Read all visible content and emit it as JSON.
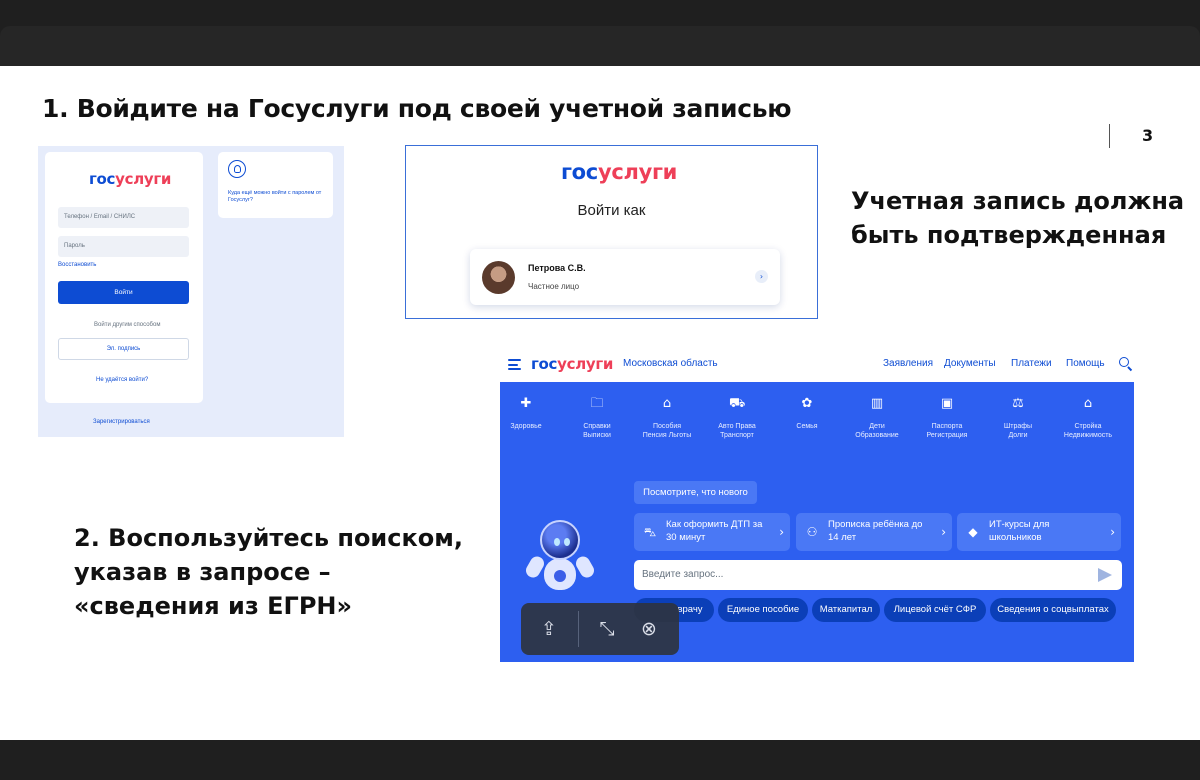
{
  "slide": {
    "title1": "1. Войдите на Госуслуги под своей учетной записью",
    "page_number": "3",
    "note1_line1": "Учетная запись должна",
    "note1_line2": "быть подтвержденная",
    "note2_line1": "2. Воспользуйтесь поиском,",
    "note2_line2": "указав в запросе –",
    "note2_line3": "«сведения из ЕГРН»"
  },
  "logo": {
    "part1": "гос",
    "part2": "услуги"
  },
  "login_form": {
    "phone_placeholder": "Телефон / Email / СНИЛС",
    "password_placeholder": "Пароль",
    "restore_link": "Восстановить",
    "login_button": "Войти",
    "other_way": "Войти другим способом",
    "esign_button": "Эл. подпись",
    "cant_login": "Не удаётся войти?",
    "register": "Зарегистрироваться",
    "side_text": "Куда ещё можно войти с паролем от Госуслуг?"
  },
  "login_as": {
    "heading": "Войти как",
    "name": "Петрова С.В.",
    "role": "Частное лицо"
  },
  "portal": {
    "region": "Московская область",
    "nav": [
      "Заявления",
      "Документы",
      "Платежи",
      "Помощь"
    ],
    "categories": [
      {
        "icon": "health-icon",
        "glyph": "✚",
        "line1": "Здоровье",
        "line2": ""
      },
      {
        "icon": "folder-icon",
        "glyph": "🗀",
        "line1": "Справки",
        "line2": "Выписки"
      },
      {
        "icon": "benefits-icon",
        "glyph": "⌂",
        "line1": "Пособия",
        "line2": "Пенсия Льготы"
      },
      {
        "icon": "car-icon",
        "glyph": "⛟",
        "line1": "Авто Права",
        "line2": "Транспорт"
      },
      {
        "icon": "family-icon",
        "glyph": "✿",
        "line1": "Семья",
        "line2": ""
      },
      {
        "icon": "book-icon",
        "glyph": "▥",
        "line1": "Дети",
        "line2": "Образование"
      },
      {
        "icon": "passport-icon",
        "glyph": "▣",
        "line1": "Паспорта",
        "line2": "Регистрация"
      },
      {
        "icon": "gavel-icon",
        "glyph": "⚖",
        "line1": "Штрафы",
        "line2": "Долги"
      },
      {
        "icon": "house-icon",
        "glyph": "⌂",
        "line1": "Стройка",
        "line2": "Недвижимость"
      }
    ],
    "news_button": "Посмотрите, что нового",
    "tiles": [
      {
        "icon": "car-icon",
        "glyph": "⛍",
        "line1": "Как оформить ДТП за",
        "line2": "30 минут"
      },
      {
        "icon": "people-icon",
        "glyph": "⚇",
        "line1": "Прописка ребёнка до",
        "line2": "14 лет"
      },
      {
        "icon": "graduation-icon",
        "glyph": "◆",
        "line1": "ИТ-курсы для",
        "line2": "школьников"
      }
    ],
    "search_placeholder": "Введите запрос...",
    "chips": [
      "Запись к врачу",
      "Единое пособие",
      "Маткапитал",
      "Лицевой счёт СФР",
      "Сведения о соцвыплатах"
    ],
    "chip_first_visible": "врачу"
  },
  "toolbar": {
    "share": "⇪",
    "collapse": "⤡",
    "close": "⊗"
  }
}
